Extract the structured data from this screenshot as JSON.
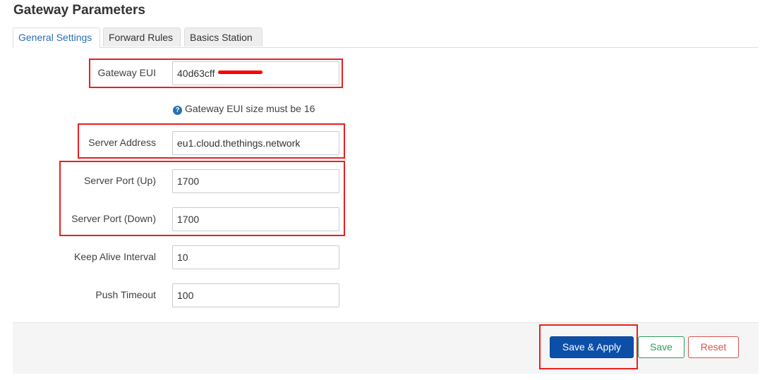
{
  "page": {
    "title": "Gateway Parameters"
  },
  "tabs": [
    {
      "label": "General Settings",
      "active": true
    },
    {
      "label": "Forward Rules",
      "active": false
    },
    {
      "label": "Basics Station",
      "active": false
    }
  ],
  "form": {
    "gateway_eui": {
      "label": "Gateway EUI",
      "value": "40d63cff"
    },
    "gateway_eui_hint": "Gateway EUI size must be 16",
    "server_address": {
      "label": "Server Address",
      "value": "eu1.cloud.thethings.network"
    },
    "server_port_up": {
      "label": "Server Port (Up)",
      "value": "1700"
    },
    "server_port_down": {
      "label": "Server Port (Down)",
      "value": "1700"
    },
    "keep_alive_interval": {
      "label": "Keep Alive Interval",
      "value": "10"
    },
    "push_timeout": {
      "label": "Push Timeout",
      "value": "100"
    }
  },
  "actions": {
    "save_apply": "Save & Apply",
    "save": "Save",
    "reset": "Reset"
  },
  "icons": {
    "help": "question-circle-icon"
  },
  "colors": {
    "primary": "#0b4fa8",
    "success": "#2e9a5c",
    "danger": "#d9534f",
    "highlight": "#e8201e",
    "active_tab_text": "#2a6fb0"
  }
}
